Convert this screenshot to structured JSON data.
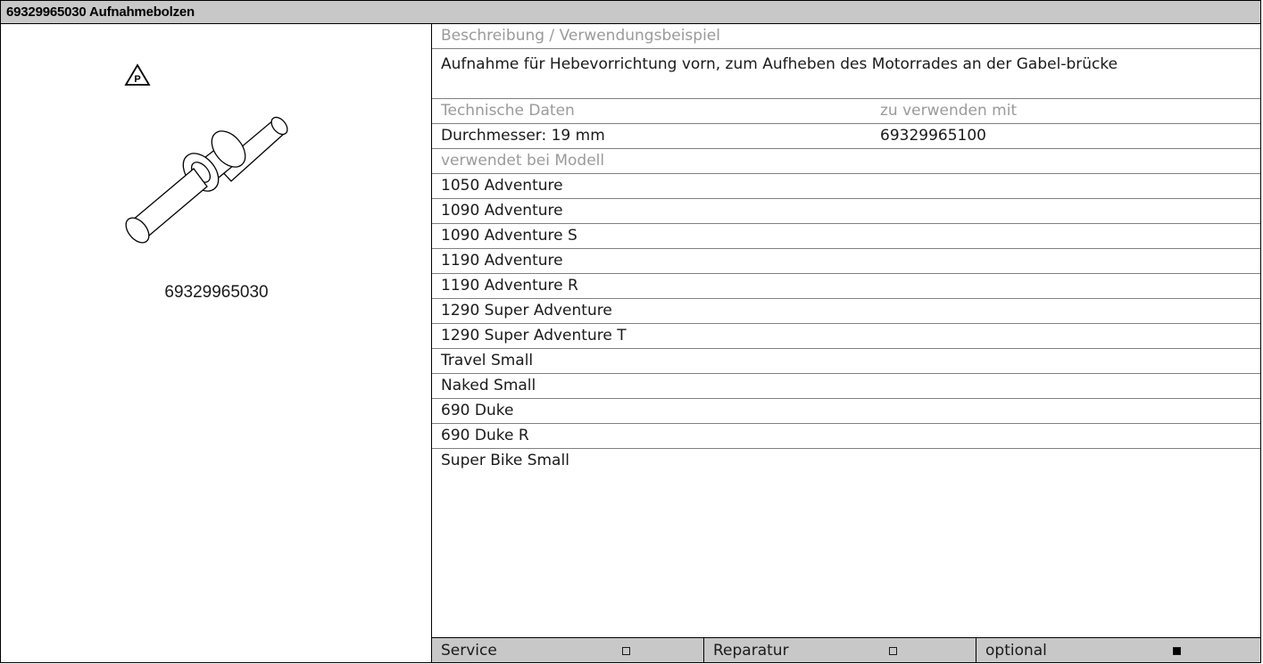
{
  "header": {
    "title": "69329965030 Aufnahmebolzen"
  },
  "image": {
    "icon": "warning-triangle-p-icon",
    "caption": "69329965030"
  },
  "description": {
    "label": "Beschreibung / Verwendungsbeispiel",
    "text": "Aufnahme für Hebevorrichtung vorn, zum Aufheben des Motorrades an der Gabel-brücke"
  },
  "technical": {
    "label": "Technische Daten",
    "value": "Durchmesser: 19 mm",
    "use_with_label": "zu verwenden mit",
    "use_with_value": "69329965100"
  },
  "models": {
    "label": "verwendet bei Modell",
    "items": [
      "1050 Adventure",
      "1090 Adventure",
      "1090 Adventure S",
      "1190 Adventure",
      "1190 Adventure R",
      "1290 Super Adventure",
      "1290 Super Adventure T",
      "Travel Small",
      "Naked Small",
      "690 Duke",
      "690 Duke R",
      "Super Bike Small"
    ]
  },
  "footer": {
    "service_label": "Service",
    "service_checked": false,
    "repair_label": "Reparatur",
    "repair_checked": false,
    "optional_label": "optional",
    "optional_checked": true
  }
}
